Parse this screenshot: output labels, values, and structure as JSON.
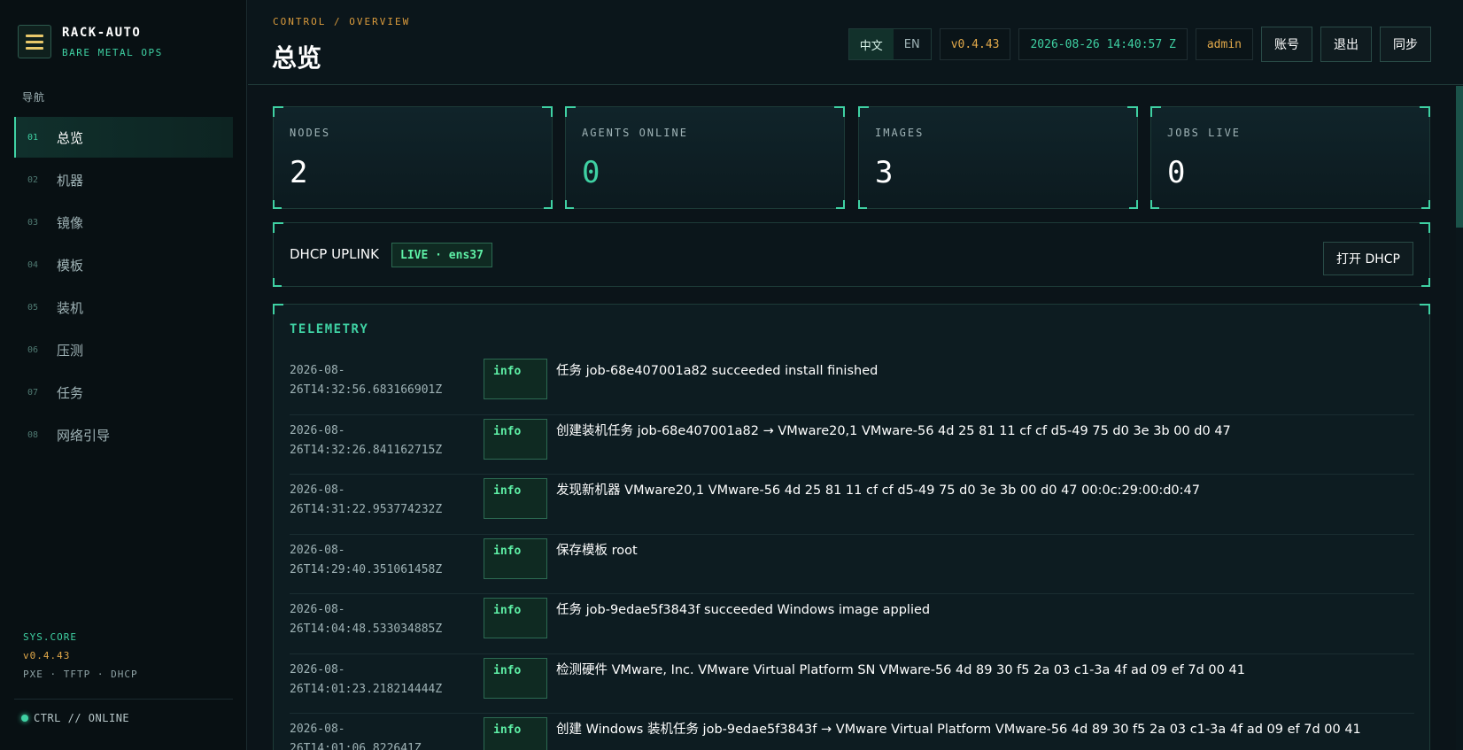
{
  "brand": {
    "title": "RACK-AUTO",
    "subtitle": "BARE METAL OPS"
  },
  "nav": {
    "heading": "导航",
    "items": [
      {
        "num": "01",
        "label": "总览"
      },
      {
        "num": "02",
        "label": "机器"
      },
      {
        "num": "03",
        "label": "镜像"
      },
      {
        "num": "04",
        "label": "模板"
      },
      {
        "num": "05",
        "label": "装机"
      },
      {
        "num": "06",
        "label": "压测"
      },
      {
        "num": "07",
        "label": "任务"
      },
      {
        "num": "08",
        "label": "网络引导"
      }
    ],
    "active_index": 0
  },
  "sys": {
    "core": "SYS.CORE",
    "version": "v0.4.43",
    "protocols": "PXE · TFTP · DHCP",
    "status": "CTRL // ONLINE"
  },
  "header": {
    "breadcrumb": "CONTROL / OVERVIEW",
    "title": "总览",
    "lang_zh": "中文",
    "lang_en": "EN",
    "version": "v0.4.43",
    "datetime": "2026-08-26 14:40:57 Z",
    "user": "admin",
    "account_button": "账号",
    "logout_button": "退出",
    "sync_button": "同步"
  },
  "stats": [
    {
      "label": "NODES",
      "value": "2"
    },
    {
      "label": "AGENTS ONLINE",
      "value": "0"
    },
    {
      "label": "IMAGES",
      "value": "3"
    },
    {
      "label": "JOBS LIVE",
      "value": "0"
    }
  ],
  "dhcp": {
    "title": "DHCP UPLINK",
    "badge": "LIVE · ens37",
    "button": "打开 DHCP"
  },
  "telemetry": {
    "title": "TELEMETRY",
    "rows": [
      {
        "time_date": "2026-08-",
        "time_rest": "26T14:32:56.683166901Z",
        "level": "info",
        "message": "任务 job-68e407001a82 succeeded install finished"
      },
      {
        "time_date": "2026-08-",
        "time_rest": "26T14:32:26.841162715Z",
        "level": "info",
        "message": "创建装机任务 job-68e407001a82 → VMware20,1 VMware-56 4d 25 81 11 cf cf d5-49 75 d0 3e 3b 00 d0 47"
      },
      {
        "time_date": "2026-08-",
        "time_rest": "26T14:31:22.953774232Z",
        "level": "info",
        "message": "发现新机器 VMware20,1 VMware-56 4d 25 81 11 cf cf d5-49 75 d0 3e 3b 00 d0 47 00:0c:29:00:d0:47"
      },
      {
        "time_date": "2026-08-",
        "time_rest": "26T14:29:40.351061458Z",
        "level": "info",
        "message": "保存模板 root"
      },
      {
        "time_date": "2026-08-",
        "time_rest": "26T14:04:48.533034885Z",
        "level": "info",
        "message": "任务 job-9edae5f3843f succeeded Windows image applied"
      },
      {
        "time_date": "2026-08-",
        "time_rest": "26T14:01:23.218214444Z",
        "level": "info",
        "message": "检测硬件 VMware, Inc. VMware Virtual Platform SN VMware-56 4d 89 30 f5 2a 03 c1-3a 4f ad 09 ef 7d 00 41"
      },
      {
        "time_date": "2026-08-",
        "time_rest": "26T14:01:06.822641Z",
        "level": "info",
        "message": "创建 Windows 装机任务 job-9edae5f3843f → VMware Virtual Platform VMware-56 4d 89 30 f5 2a 03 c1-3a 4f ad 09 ef 7d 00 41"
      }
    ]
  },
  "colors": {
    "accent": "#3fd1a3",
    "warn": "#e2a94a",
    "bg": "#0b1419"
  }
}
